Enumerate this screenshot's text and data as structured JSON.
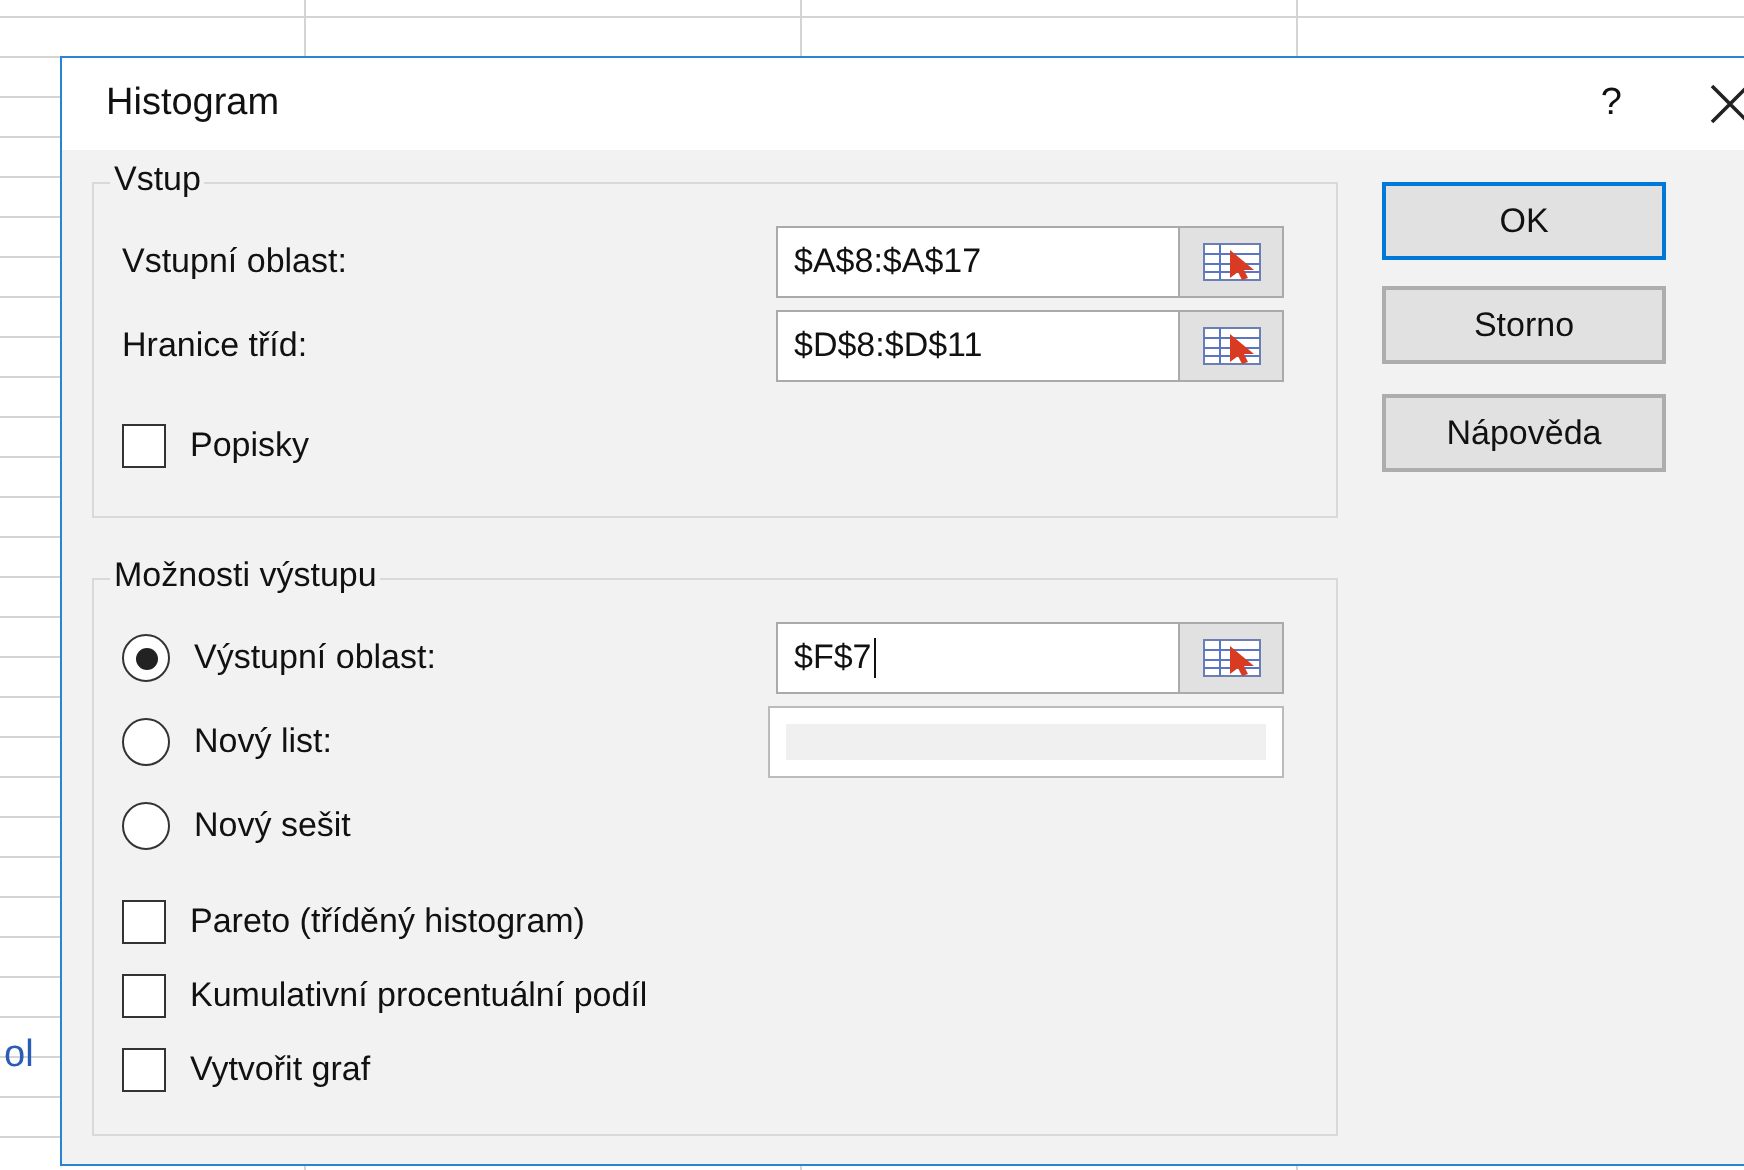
{
  "background": {
    "cut_text": "ol"
  },
  "window": {
    "title": "Histogram",
    "help": "?"
  },
  "input_group": {
    "title": "Vstup",
    "fields": [
      {
        "label": "Vstupní oblast:",
        "value": "$A$8:$A$17"
      },
      {
        "label": "Hranice tříd:",
        "value": "$D$8:$D$11"
      }
    ],
    "labels_checkbox": {
      "label": "Popisky",
      "checked": false
    }
  },
  "output_group": {
    "title": "Možnosti výstupu",
    "options": [
      {
        "label": "Výstupní oblast:",
        "selected": true,
        "field": {
          "value": "$F$7",
          "disabled": false,
          "focused": true
        }
      },
      {
        "label": "Nový list:",
        "selected": false,
        "field": {
          "disabled": true
        }
      },
      {
        "label": "Nový sešit",
        "selected": false
      }
    ],
    "checkboxes": [
      {
        "label": "Pareto (tříděný histogram)",
        "checked": false
      },
      {
        "label": "Kumulativní procentuální podíl",
        "checked": false
      },
      {
        "label": "Vytvořit graf",
        "checked": false
      }
    ]
  },
  "buttons": [
    {
      "label": "OK",
      "default": true
    },
    {
      "label": "Storno",
      "default": false
    },
    {
      "label": "Nápověda",
      "default": false
    }
  ]
}
